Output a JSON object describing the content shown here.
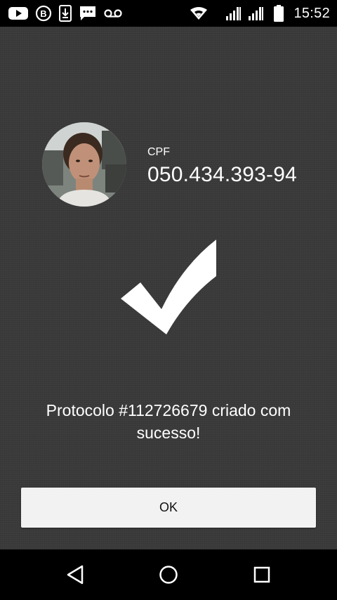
{
  "status_bar": {
    "time": "15:52",
    "left_icons": [
      "youtube-icon",
      "b-badge-icon",
      "download-icon",
      "sms-icon",
      "voicemail-icon"
    ],
    "right_icons": [
      "wifi-icon",
      "signal-icon",
      "signal-icon",
      "battery-icon"
    ]
  },
  "profile": {
    "cpf_label": "CPF",
    "cpf_value": "050.434.393-94"
  },
  "result": {
    "icon": "checkmark-icon",
    "message": "Protocolo #112726679 criado com sucesso!"
  },
  "actions": {
    "ok_label": "OK"
  },
  "nav_bar": {
    "icons": [
      "back-icon",
      "home-icon",
      "recents-icon"
    ]
  },
  "colors": {
    "background": "#3a3a3a",
    "button": "#f2f2f2",
    "text": "#ffffff"
  }
}
